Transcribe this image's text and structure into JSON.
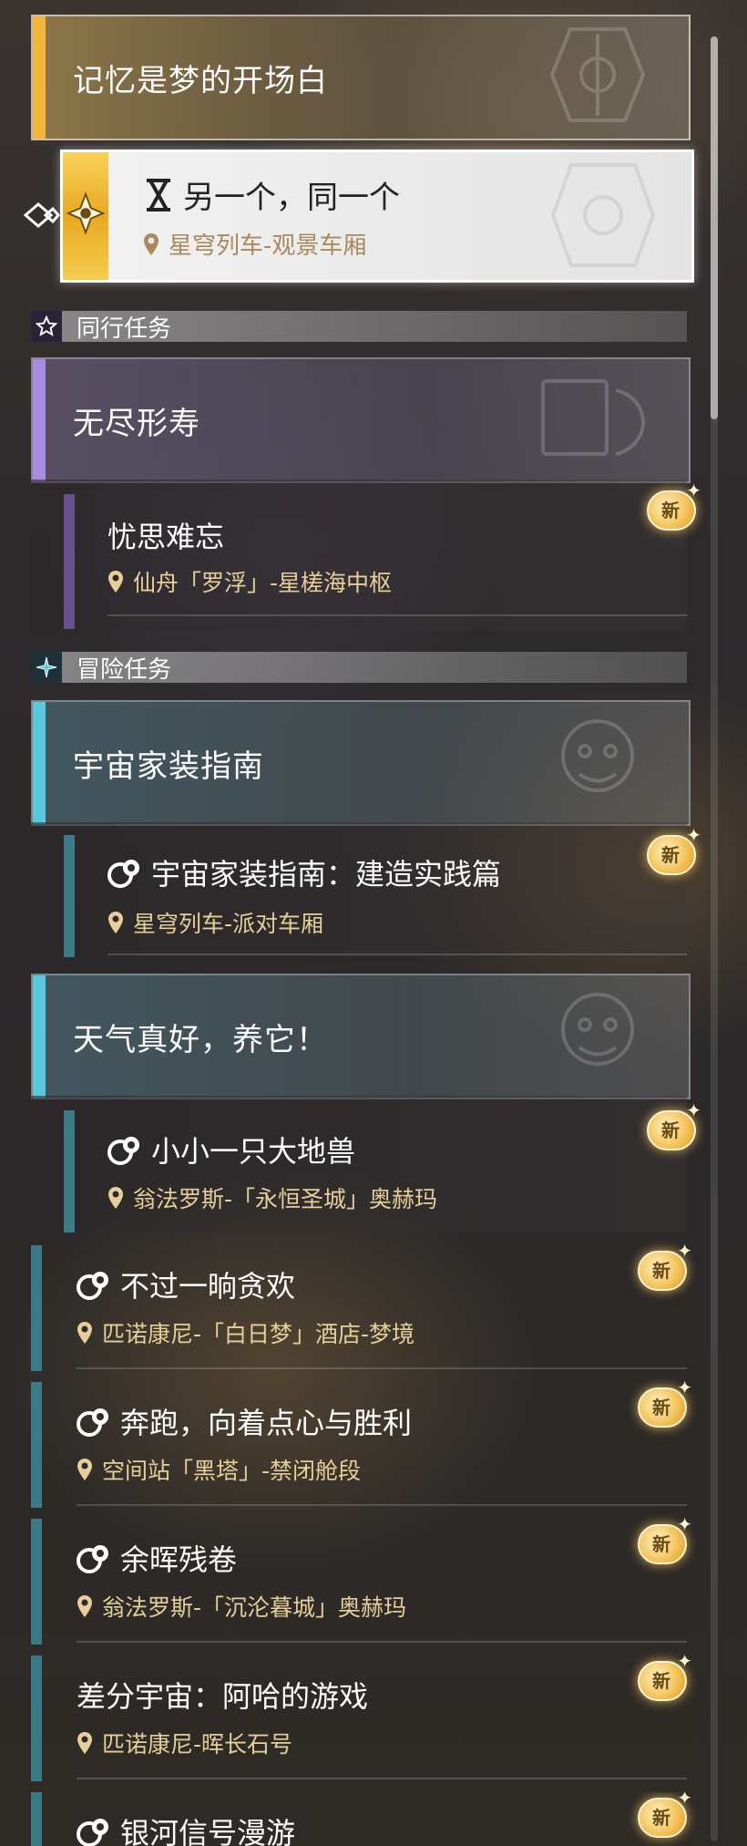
{
  "main_quest": {
    "title": "记忆是梦的开场白",
    "selected": {
      "title": "另一个，同一个",
      "location": "星穹列车-观景车厢"
    }
  },
  "sections": {
    "companion": {
      "label": "同行任务",
      "icon": "star-icon"
    },
    "adventure": {
      "label": "冒险任务",
      "icon": "sparkle-icon"
    }
  },
  "companion_quests": {
    "group_title": "无尽形寿",
    "item": {
      "title": "忧思难忘",
      "location": "仙舟「罗浮」-星槎海中枢"
    }
  },
  "adventure_groups": [
    {
      "title": "宇宙家装指南",
      "item": {
        "title": "宇宙家装指南：建造实践篇",
        "location": "星穹列车-派对车厢"
      }
    },
    {
      "title": "天气真好，养它！",
      "item": {
        "title": "小小一只大地兽",
        "location": "翁法罗斯-「永恒圣城」奥赫玛"
      }
    }
  ],
  "adventure_items": [
    {
      "title": "不过一晌贪欢",
      "location": "匹诺康尼-「白日梦」酒店-梦境"
    },
    {
      "title": "奔跑，向着点心与胜利",
      "location": "空间站「黑塔」-禁闭舱段"
    },
    {
      "title": "余晖残卷",
      "location": "翁法罗斯-「沉沦暮城」奥赫玛"
    },
    {
      "title": "差分宇宙：阿哈的游戏",
      "location": "匹诺康尼-晖长石号"
    },
    {
      "title": "银河信号漫游",
      "location": ""
    }
  ],
  "badges": {
    "new_label": "新"
  },
  "colors": {
    "main_accent": "#f2b63b",
    "companion_accent": "#a98be0",
    "adventure_accent": "#5cc8df",
    "location_text": "#e6cf9a"
  }
}
